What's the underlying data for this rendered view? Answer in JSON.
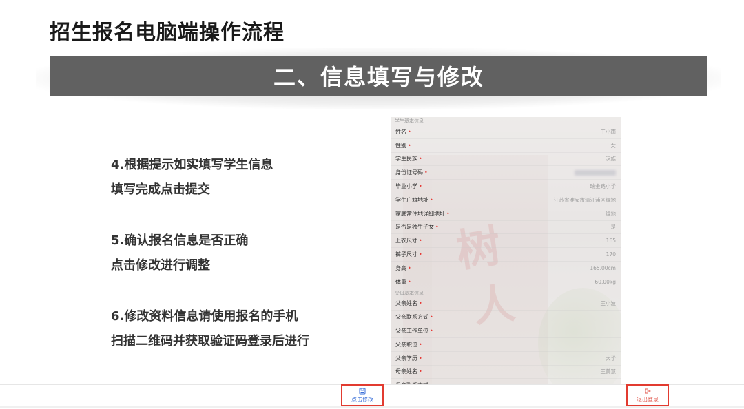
{
  "slide": {
    "title": "招生报名电脑端操作流程",
    "banner": "二、信息填写与修改"
  },
  "steps": [
    {
      "line1": "4.根据提示如实填写学生信息",
      "line2": "填写完成点击提交"
    },
    {
      "line1": "5.确认报名信息是否正确",
      "line2": "点击修改进行调整"
    },
    {
      "line1": "6.修改资料信息请使用报名的手机",
      "line2": "扫描二维码并获取验证码登录后进行"
    }
  ],
  "phone": {
    "student_section": "学生基本信息",
    "student_rows": [
      {
        "label": "姓名",
        "value": "王小雨"
      },
      {
        "label": "性别",
        "value": "女"
      },
      {
        "label": "学生民族",
        "value": "汉族"
      },
      {
        "label": "身份证号码",
        "value": ""
      },
      {
        "label": "毕业小学",
        "value": "瑞金路小学"
      },
      {
        "label": "学生户籍地址",
        "value": "江苏省淮安市清江浦区绿地"
      },
      {
        "label": "家庭常住地详细地址",
        "value": "绿地"
      },
      {
        "label": "是否是独生子女",
        "value": "是"
      },
      {
        "label": "上衣尺寸",
        "value": "165"
      },
      {
        "label": "裤子尺寸",
        "value": "170"
      },
      {
        "label": "身高",
        "value": "165.00cm"
      },
      {
        "label": "体重",
        "value": "60.00kg"
      }
    ],
    "parent_section": "父母基本信息",
    "parent_rows": [
      {
        "label": "父亲姓名",
        "value": "王小波"
      },
      {
        "label": "父亲联系方式",
        "value": ""
      },
      {
        "label": "父亲工作单位",
        "value": ""
      },
      {
        "label": "父亲职位",
        "value": ""
      },
      {
        "label": "父亲学历",
        "value": "大学"
      },
      {
        "label": "母亲姓名",
        "value": "王美慧"
      },
      {
        "label": "母亲联系方式",
        "value": ""
      }
    ],
    "bg_chars": [
      "树",
      "人"
    ]
  },
  "bottom_bar": {
    "save_label": "点击修改",
    "logout_label": "退出登录",
    "accent": "#3a6fd8",
    "highlight": "#e23b30"
  }
}
